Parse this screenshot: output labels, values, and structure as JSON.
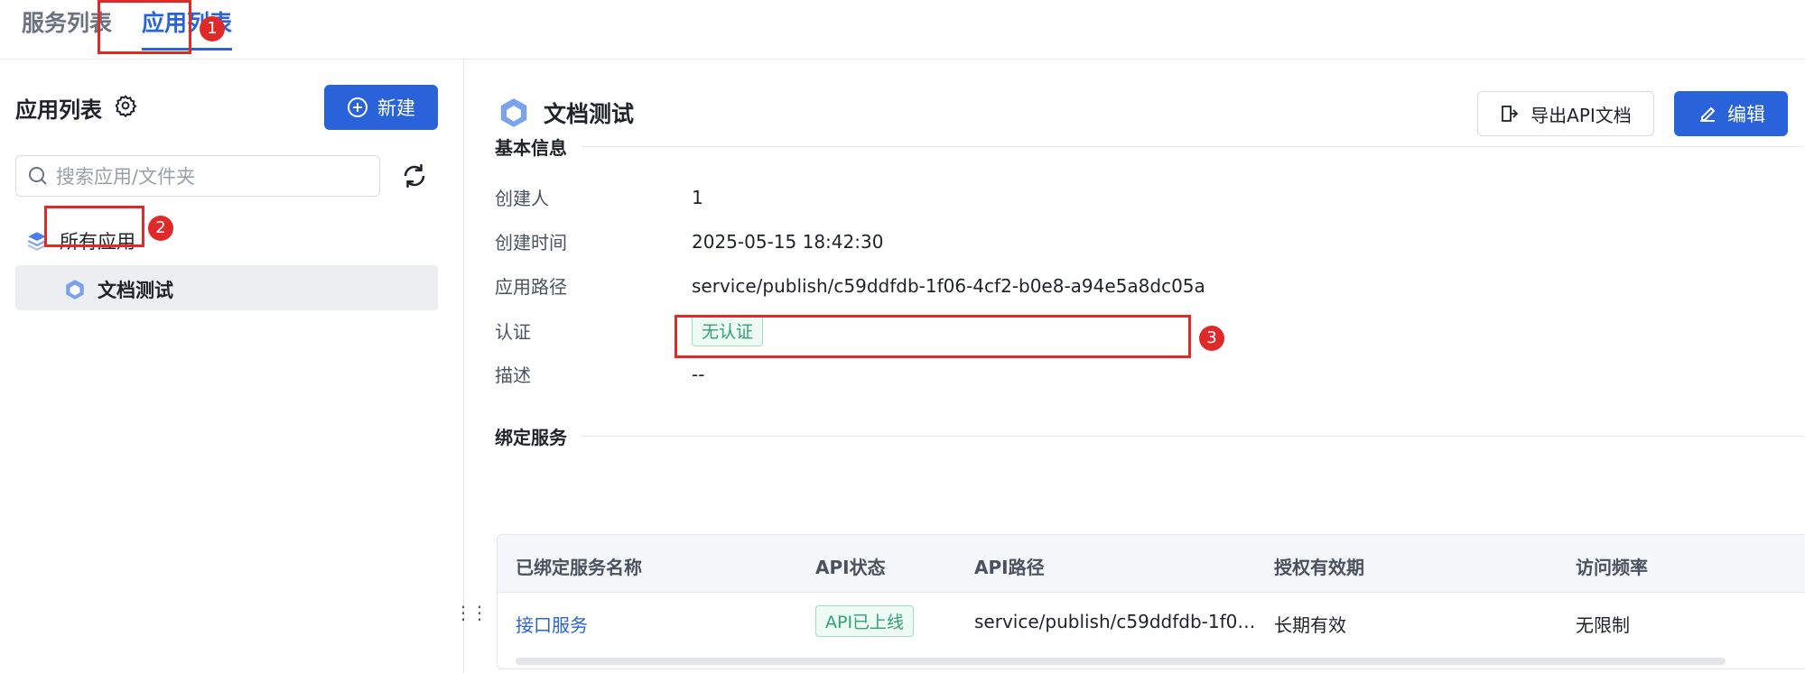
{
  "top_tabs": [
    "服务列表",
    "应用列表"
  ],
  "callouts": [
    "1",
    "2",
    "3"
  ],
  "sidebar": {
    "title": "应用列表",
    "new_label": "新建",
    "search_placeholder": "搜索应用/文件夹",
    "tree_root": "所有应用",
    "tree_item": "文档测试"
  },
  "main": {
    "title": "文档测试",
    "export_label": "导出API文档",
    "edit_label": "编辑",
    "basic_section": "基本信息",
    "info": [
      {
        "label": "创建人",
        "value": "1"
      },
      {
        "label": "创建时间",
        "value": "2025-05-15 18:42:30"
      },
      {
        "label": "应用路径",
        "value": "service/publish/c59ddfdb-1f06-4cf2-b0e8-a94e5a8dc05a"
      },
      {
        "label": "认证",
        "value": "无认证"
      },
      {
        "label": "描述",
        "value": "--"
      }
    ],
    "bind_section": "绑定服务",
    "table": {
      "headers": [
        "已绑定服务名称",
        "API状态",
        "API路径",
        "授权有效期",
        "访问频率"
      ],
      "rows": [
        [
          "接口服务",
          "API已上线",
          "service/publish/c59ddfdb-1f0…",
          "长期有效",
          "无限制"
        ]
      ]
    }
  },
  "colors": {
    "primary": "#2a63d9",
    "annotation": "#e02a2a",
    "success": "#2fa173"
  }
}
